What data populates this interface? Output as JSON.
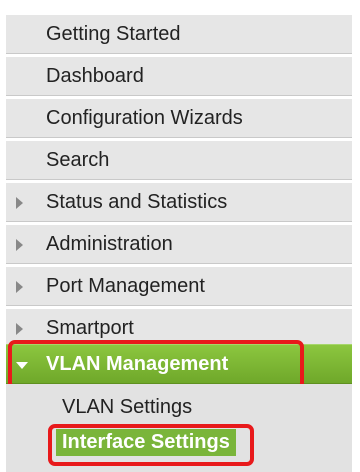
{
  "nav": {
    "items": [
      {
        "label": "Getting Started"
      },
      {
        "label": "Dashboard"
      },
      {
        "label": "Configuration Wizards"
      },
      {
        "label": "Search"
      },
      {
        "label": "Status and Statistics"
      },
      {
        "label": "Administration"
      },
      {
        "label": "Port Management"
      },
      {
        "label": "Smartport"
      },
      {
        "label": "VLAN Management"
      }
    ],
    "sub_items": [
      {
        "label": "VLAN Settings"
      },
      {
        "label": "Interface Settings"
      }
    ]
  },
  "colors": {
    "active_green": "#7ab53a",
    "highlight_red": "#e8191b",
    "menu_gray": "#e6e6e6"
  }
}
